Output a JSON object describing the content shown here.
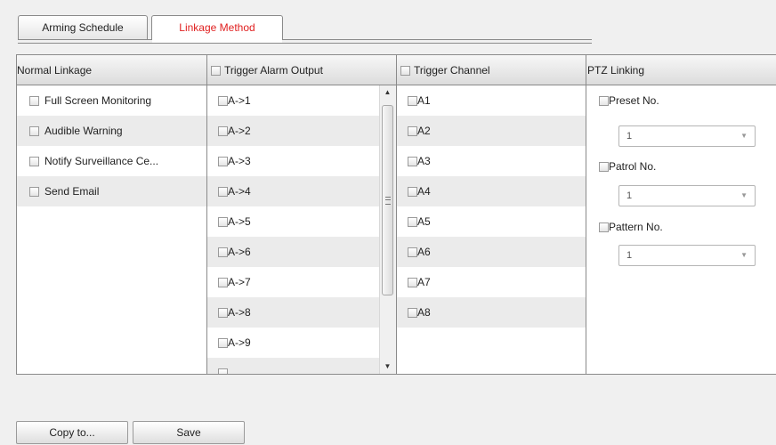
{
  "tabs": [
    {
      "label": "Arming Schedule",
      "active": false
    },
    {
      "label": "Linkage Method",
      "active": true
    }
  ],
  "columns": {
    "normal": {
      "header": "Normal Linkage",
      "items": [
        "Full Screen Monitoring",
        "Audible Warning",
        "Notify Surveillance Ce...",
        "Send Email"
      ]
    },
    "alarm_output": {
      "header": "Trigger Alarm Output",
      "items": [
        "A->1",
        "A->2",
        "A->3",
        "A->4",
        "A->5",
        "A->6",
        "A->7",
        "A->8",
        "A->9"
      ]
    },
    "channel": {
      "header": "Trigger Channel",
      "items": [
        "A1",
        "A2",
        "A3",
        "A4",
        "A5",
        "A6",
        "A7",
        "A8"
      ]
    },
    "ptz": {
      "header": "PTZ Linking",
      "preset": {
        "label": "Preset No.",
        "value": "1"
      },
      "patrol": {
        "label": "Patrol No.",
        "value": "1"
      },
      "pattern": {
        "label": "Pattern No.",
        "value": "1"
      }
    }
  },
  "buttons": {
    "copy": "Copy to...",
    "save": "Save"
  },
  "colors": {
    "active_tab_text": "#e02020",
    "row_alt": "#ebebeb",
    "border": "#8a8a8a"
  }
}
